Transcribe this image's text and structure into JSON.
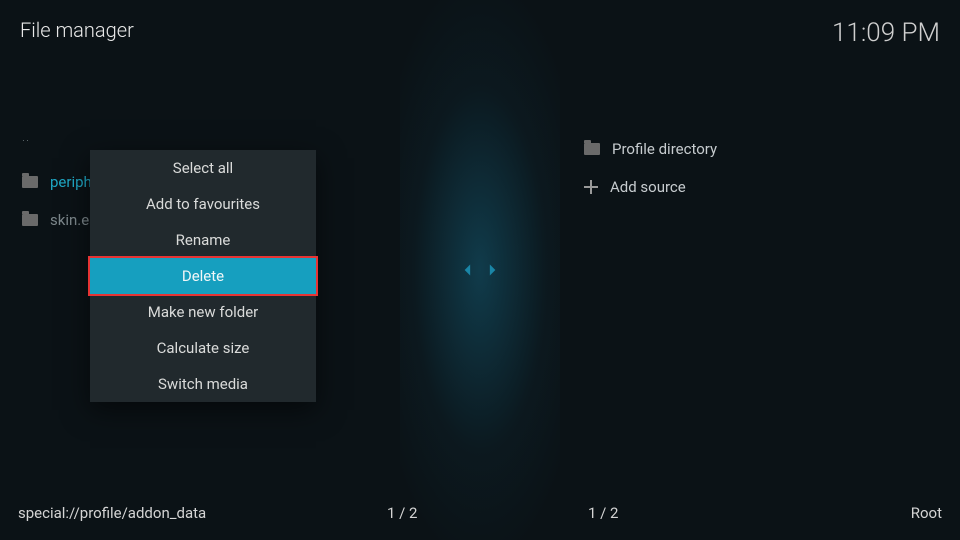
{
  "header": {
    "title": "File manager",
    "clock": "11:09 PM"
  },
  "left_pane": {
    "parent": "..",
    "items": [
      {
        "label": "peripheral",
        "active": true
      },
      {
        "label": "skin.estu",
        "active": false
      }
    ]
  },
  "right_pane": {
    "items": [
      {
        "label": "Profile directory",
        "type": "folder"
      },
      {
        "label": "Add source",
        "type": "add"
      }
    ]
  },
  "context_menu": {
    "items": [
      {
        "label": "Select all"
      },
      {
        "label": "Add to favourites"
      },
      {
        "label": "Rename"
      },
      {
        "label": "Delete",
        "selected": true
      },
      {
        "label": "Make new folder"
      },
      {
        "label": "Calculate size"
      },
      {
        "label": "Switch media"
      }
    ]
  },
  "footer": {
    "path": "special://profile/addon_data",
    "count_left": "1 / 2",
    "count_right": "1 / 2",
    "root": "Root"
  }
}
